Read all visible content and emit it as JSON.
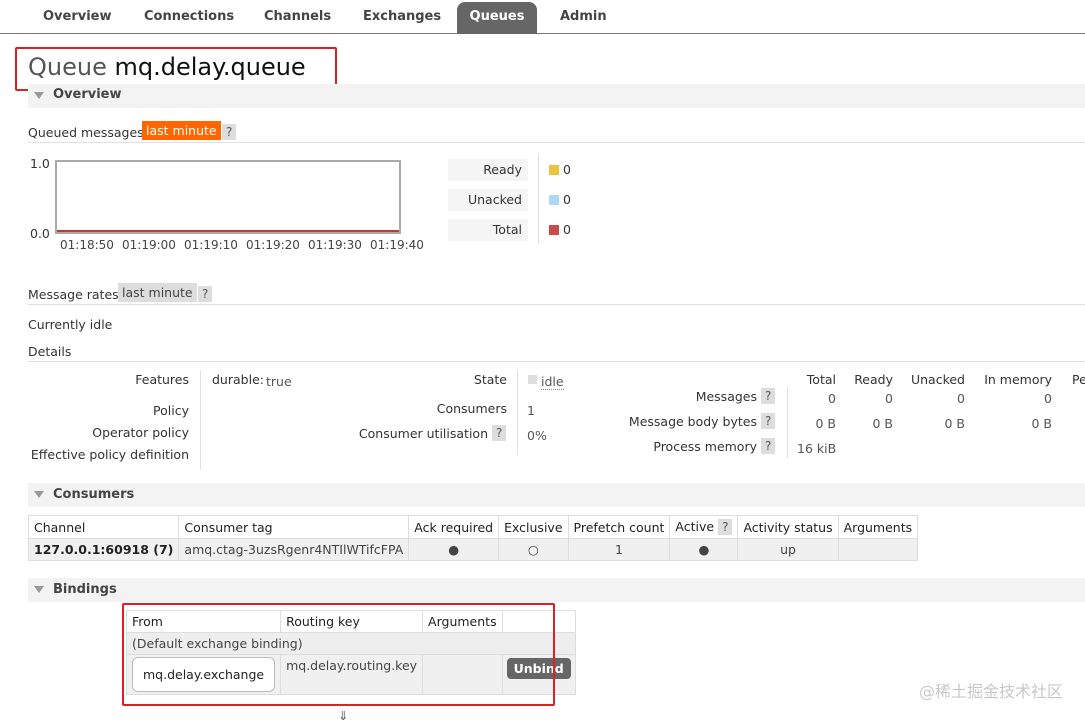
{
  "nav": {
    "tabs": [
      "Overview",
      "Connections",
      "Channels",
      "Exchanges",
      "Queues",
      "Admin"
    ],
    "active": "Queues"
  },
  "page": {
    "title_prefix": "Queue",
    "queue_name": "mq.delay.queue"
  },
  "overview": {
    "heading": "Overview",
    "queued_label": "Queued messages",
    "queued_range": "last minute",
    "help": "?",
    "chart_ymax": "1.0",
    "chart_ymin": "0.0",
    "legend": [
      {
        "label": "Ready",
        "value": "0",
        "color": "#edc240"
      },
      {
        "label": "Unacked",
        "value": "0",
        "color": "#afd8f8"
      },
      {
        "label": "Total",
        "value": "0",
        "color": "#cb4b4b"
      }
    ],
    "rates_label": "Message rates",
    "rates_range": "last minute",
    "idle_text": "Currently idle",
    "details_label": "Details"
  },
  "chart_data": {
    "type": "line",
    "x": [
      "01:18:50",
      "01:19:00",
      "01:19:10",
      "01:19:20",
      "01:19:30",
      "01:19:40"
    ],
    "series": [
      {
        "name": "Ready",
        "values": [
          0,
          0,
          0,
          0,
          0,
          0
        ]
      },
      {
        "name": "Unacked",
        "values": [
          0,
          0,
          0,
          0,
          0,
          0
        ]
      },
      {
        "name": "Total",
        "values": [
          0,
          0,
          0,
          0,
          0,
          0
        ]
      }
    ],
    "ylim": [
      0.0,
      1.0
    ]
  },
  "details": {
    "features_label": "Features",
    "features_key": "durable:",
    "features_value": "true",
    "policy_label": "Policy",
    "operator_policy_label": "Operator policy",
    "effective_policy_label": "Effective policy definition",
    "state_label": "State",
    "state_value": "idle",
    "consumers_label": "Consumers",
    "consumers_value": "1",
    "utilisation_label": "Consumer utilisation",
    "utilisation_value": "0%",
    "stats_headers": [
      "Total",
      "Ready",
      "Unacked",
      "In memory",
      "Pe"
    ],
    "messages_label": "Messages",
    "messages_values": [
      "0",
      "0",
      "0",
      "0"
    ],
    "body_bytes_label": "Message body bytes",
    "body_bytes_values": [
      "0 B",
      "0 B",
      "0 B",
      "0 B"
    ],
    "process_memory_label": "Process memory",
    "process_memory_value": "16 kiB"
  },
  "consumers": {
    "heading": "Consumers",
    "headers": [
      "Channel",
      "Consumer tag",
      "Ack required",
      "Exclusive",
      "Prefetch count",
      "Active",
      "Activity status",
      "Arguments"
    ],
    "active_help": "?",
    "row": {
      "channel": "127.0.0.1:60918 (7)",
      "tag": "amq.ctag-3uzsRgenr4NTIlWTifcFPA",
      "ack": "●",
      "exclusive": "○",
      "prefetch": "1",
      "active": "●",
      "status": "up",
      "arguments": ""
    }
  },
  "bindings": {
    "heading": "Bindings",
    "headers": [
      "From",
      "Routing key",
      "Arguments"
    ],
    "default_binding": "(Default exchange binding)",
    "exchange": "mq.delay.exchange",
    "routing_key": "mq.delay.routing.key",
    "unbind_label": "Unbind"
  },
  "footer": {
    "glyph": "⇓"
  },
  "watermark": "@稀土掘金技术社区"
}
